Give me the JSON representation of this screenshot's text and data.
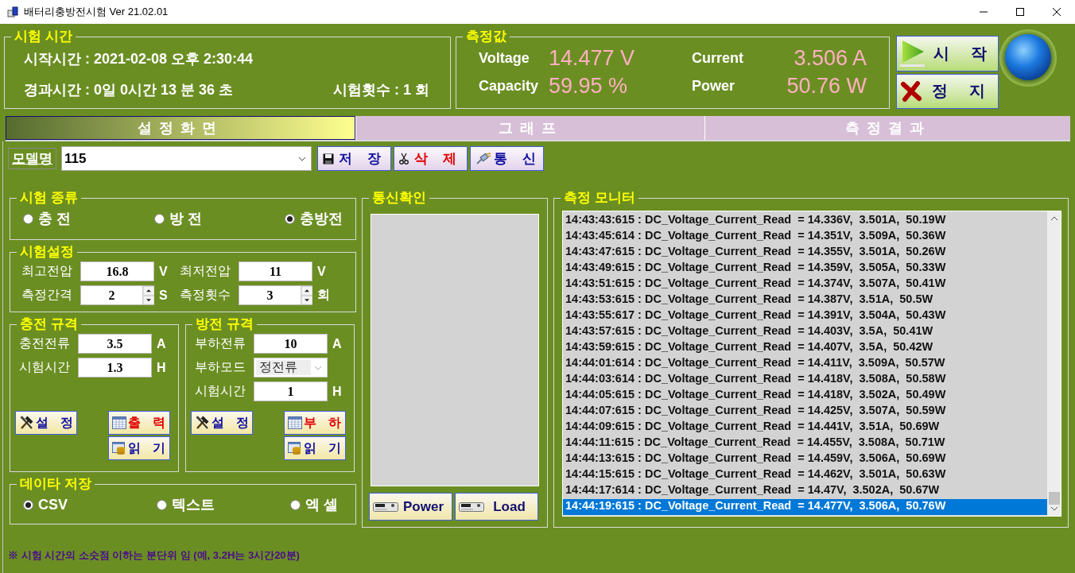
{
  "window": {
    "title": "배터리충방전시험 Ver 21.02.01"
  },
  "test_time": {
    "title": "시험 시간",
    "start": "시작시간 : 2021-02-08 오후 2:30:44",
    "elapsed": "경과시간 : 0일 0시간 13 분 36 초",
    "count": "시험횟수 : 1 회"
  },
  "measurements": {
    "title": "측정값",
    "items": [
      {
        "label": "Voltage",
        "value": "14.477 V"
      },
      {
        "label": "Current",
        "value": "3.506 A"
      },
      {
        "label": "Capacity",
        "value": "59.95 %"
      },
      {
        "label": "Power",
        "value": "50.76 W"
      }
    ]
  },
  "run_buttons": [
    {
      "kind": "start",
      "label": "시 작"
    },
    {
      "kind": "stop",
      "label": "정 지"
    }
  ],
  "tabs": [
    {
      "label": "설정화면",
      "selected": true
    },
    {
      "label": "그래프",
      "selected": false
    },
    {
      "label": "측정결과",
      "selected": false
    }
  ],
  "model": {
    "label": "모델명",
    "value": "115"
  },
  "model_buttons": [
    {
      "kind": "save",
      "label": "저 장"
    },
    {
      "kind": "delete",
      "label": "삭 제"
    },
    {
      "kind": "comm",
      "label": "통 신"
    }
  ],
  "test_type": {
    "title": "시험 종류",
    "options": [
      {
        "label": "충 전",
        "selected": false
      },
      {
        "label": "방 전",
        "selected": false
      },
      {
        "label": "충방전",
        "selected": true
      }
    ]
  },
  "test_settings": {
    "title": "시험설정",
    "fields": [
      {
        "kind": "text",
        "label": "최고전압",
        "value": "16.8",
        "unit": "V"
      },
      {
        "kind": "text",
        "label": "최저전압",
        "value": "11",
        "unit": "V"
      },
      {
        "kind": "spin",
        "label": "측정간격",
        "value": "2",
        "unit": "S"
      },
      {
        "kind": "spin",
        "label": "측정횟수",
        "value": "3",
        "unit": "회"
      }
    ]
  },
  "charge_spec": {
    "title": "충전 규격",
    "fields": [
      {
        "kind": "text",
        "label": "충전전류",
        "value": "3.5",
        "unit": "A"
      },
      {
        "kind": "text",
        "label": "시험시간",
        "value": "1.3",
        "unit": "H"
      }
    ],
    "buttons": [
      {
        "kind": "setup",
        "label": "설 정"
      },
      {
        "kind": "output",
        "label": "출 력"
      },
      {
        "kind": "read",
        "label": "읽 기"
      }
    ]
  },
  "discharge_spec": {
    "title": "방전 규격",
    "fields": [
      {
        "kind": "text",
        "label": "부하전류",
        "value": "10",
        "unit": "A"
      },
      {
        "kind": "select",
        "label": "부하모드",
        "value": "정전류"
      },
      {
        "kind": "text",
        "label": "시험시간",
        "value": "1",
        "unit": "H"
      }
    ],
    "buttons": [
      {
        "kind": "setup",
        "label": "설 정"
      },
      {
        "kind": "output",
        "label": "부 하"
      },
      {
        "kind": "read",
        "label": "읽 기"
      }
    ]
  },
  "data_save": {
    "title": "데이타 저장",
    "options": [
      {
        "label": "CSV",
        "selected": true
      },
      {
        "label": "텍스트",
        "selected": false
      },
      {
        "label": "엑 셀",
        "selected": false
      }
    ]
  },
  "comm_check": {
    "title": "통신확인",
    "buttons": [
      {
        "label": "Power"
      },
      {
        "label": "Load"
      }
    ]
  },
  "monitor": {
    "title": "측정 모니터",
    "lines": [
      {
        "text": "14:43:43:615 : DC_Voltage_Current_Read  = 14.336V,  3.501A,  50.19W",
        "selected": false
      },
      {
        "text": "14:43:45:614 : DC_Voltage_Current_Read  = 14.351V,  3.509A,  50.36W",
        "selected": false
      },
      {
        "text": "14:43:47:615 : DC_Voltage_Current_Read  = 14.355V,  3.501A,  50.26W",
        "selected": false
      },
      {
        "text": "14:43:49:615 : DC_Voltage_Current_Read  = 14.359V,  3.505A,  50.33W",
        "selected": false
      },
      {
        "text": "14:43:51:615 : DC_Voltage_Current_Read  = 14.374V,  3.507A,  50.41W",
        "selected": false
      },
      {
        "text": "14:43:53:615 : DC_Voltage_Current_Read  = 14.387V,  3.51A,  50.5W",
        "selected": false
      },
      {
        "text": "14:43:55:617 : DC_Voltage_Current_Read  = 14.391V,  3.504A,  50.43W",
        "selected": false
      },
      {
        "text": "14:43:57:615 : DC_Voltage_Current_Read  = 14.403V,  3.5A,  50.41W",
        "selected": false
      },
      {
        "text": "14:43:59:615 : DC_Voltage_Current_Read  = 14.407V,  3.5A,  50.42W",
        "selected": false
      },
      {
        "text": "14:44:01:614 : DC_Voltage_Current_Read  = 14.411V,  3.509A,  50.57W",
        "selected": false
      },
      {
        "text": "14:44:03:614 : DC_Voltage_Current_Read  = 14.418V,  3.508A,  50.58W",
        "selected": false
      },
      {
        "text": "14:44:05:615 : DC_Voltage_Current_Read  = 14.418V,  3.502A,  50.49W",
        "selected": false
      },
      {
        "text": "14:44:07:615 : DC_Voltage_Current_Read  = 14.425V,  3.507A,  50.59W",
        "selected": false
      },
      {
        "text": "14:44:09:615 : DC_Voltage_Current_Read  = 14.441V,  3.51A,  50.69W",
        "selected": false
      },
      {
        "text": "14:44:11:615 : DC_Voltage_Current_Read  = 14.455V,  3.508A,  50.71W",
        "selected": false
      },
      {
        "text": "14:44:13:615 : DC_Voltage_Current_Read  = 14.459V,  3.506A,  50.69W",
        "selected": false
      },
      {
        "text": "14:44:15:615 : DC_Voltage_Current_Read  = 14.462V,  3.501A,  50.63W",
        "selected": false
      },
      {
        "text": "14:44:17:614 : DC_Voltage_Current_Read  = 14.47V,  3.502A,  50.67W",
        "selected": false
      },
      {
        "text": "14:44:19:615 : DC_Voltage_Current_Read  = 14.477V,  3.506A,  50.76W",
        "selected": true
      }
    ]
  },
  "note": "※ 시험 시간의 소숫점 이하는 분단위 임 (예, 3.2H는 3시간20분)"
}
